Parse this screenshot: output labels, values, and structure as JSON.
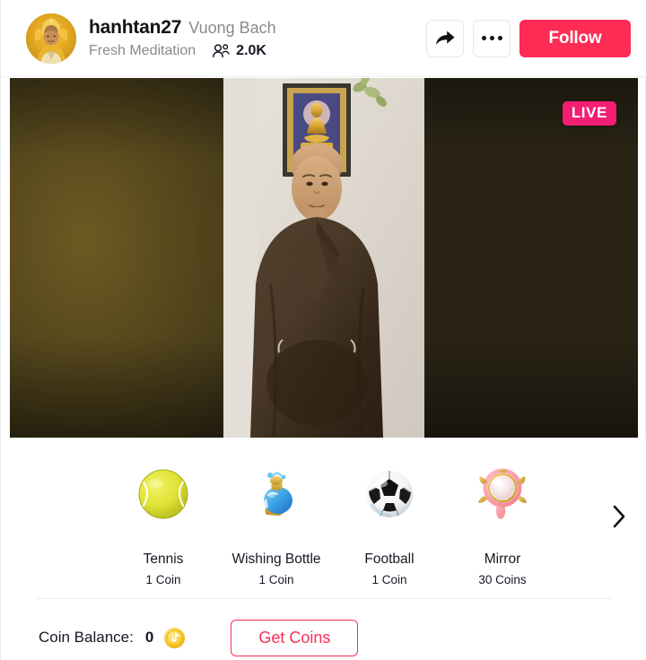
{
  "header": {
    "avatar_icon": "buddha-avatar",
    "username": "hanhtan27",
    "display_name": "Vuong Bach",
    "topic": "Fresh Meditation",
    "viewers_icon": "viewers-people-icon",
    "viewer_count": "2.0K",
    "share_icon": "share-arrow-icon",
    "more_icon": "more-options-icon",
    "follow_label": "Follow",
    "follow_color": "#fe2c55"
  },
  "video": {
    "live_label": "LIVE",
    "live_color": "#f41e73",
    "stream_description": "monk-in-brown-robe-with-buddha-painting"
  },
  "gifts": {
    "next_icon": "chevron-right-icon",
    "items": [
      {
        "icon": "tennis-ball-icon",
        "name": "Tennis",
        "price": "1 Coin"
      },
      {
        "icon": "wishing-bottle-icon",
        "name": "Wishing Bottle",
        "price": "1 Coin"
      },
      {
        "icon": "football-icon",
        "name": "Football",
        "price": "1 Coin"
      },
      {
        "icon": "mirror-icon",
        "name": "Mirror",
        "price": "30 Coins"
      }
    ]
  },
  "wallet": {
    "balance_label": "Coin Balance:",
    "balance_value": "0",
    "coin_icon": "tiktok-coin-icon",
    "get_coins_label": "Get Coins",
    "accent_color": "#fe2c55"
  }
}
